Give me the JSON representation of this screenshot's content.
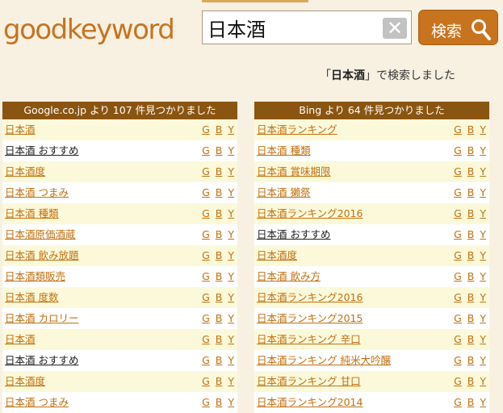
{
  "header": {
    "logo": "goodkeyword",
    "search_value": "日本酒",
    "clear_label": "✕",
    "search_button_label": "検索",
    "search_icon": "magnifier-icon"
  },
  "result_message": {
    "open": "「",
    "query": "日本酒",
    "close": "」で検索しました"
  },
  "engine_links": [
    "G",
    "B",
    "Y"
  ],
  "google": {
    "title": "Google.co.jp より 107 件見つかりました",
    "items": [
      {
        "label": "日本酒",
        "visited": false
      },
      {
        "label": "日本酒 おすすめ",
        "visited": true
      },
      {
        "label": "日本酒度",
        "visited": false
      },
      {
        "label": "日本酒 つまみ",
        "visited": false
      },
      {
        "label": "日本酒 種類",
        "visited": false
      },
      {
        "label": "日本酒原価酒蔵",
        "visited": false
      },
      {
        "label": "日本酒 飲み放題",
        "visited": false
      },
      {
        "label": "日本酒類販売",
        "visited": false
      },
      {
        "label": "日本酒 度数",
        "visited": false
      },
      {
        "label": "日本酒 カロリー",
        "visited": false
      },
      {
        "label": "日本酒",
        "visited": false
      },
      {
        "label": "日本酒 おすすめ",
        "visited": true
      },
      {
        "label": "日本酒度",
        "visited": false
      },
      {
        "label": "日本酒 つまみ",
        "visited": false
      }
    ]
  },
  "bing": {
    "title": "Bing より 64 件見つかりました",
    "items": [
      {
        "label": "日本酒ランキング",
        "visited": false
      },
      {
        "label": "日本酒 種類",
        "visited": false
      },
      {
        "label": "日本酒 賞味期限",
        "visited": false
      },
      {
        "label": "日本酒 獺祭",
        "visited": false
      },
      {
        "label": "日本酒ランキング2016",
        "visited": false
      },
      {
        "label": "日本酒 おすすめ",
        "visited": true
      },
      {
        "label": "日本酒度",
        "visited": false
      },
      {
        "label": "日本酒 飲み方",
        "visited": false
      },
      {
        "label": "日本酒ランキング2016",
        "visited": false
      },
      {
        "label": "日本酒ランキング2015",
        "visited": false
      },
      {
        "label": "日本酒ランキング 辛口",
        "visited": false
      },
      {
        "label": "日本酒ランキング 純米大吟醸",
        "visited": false
      },
      {
        "label": "日本酒ランキング 甘口",
        "visited": false
      },
      {
        "label": "日本酒ランキング2014",
        "visited": false
      }
    ]
  }
}
